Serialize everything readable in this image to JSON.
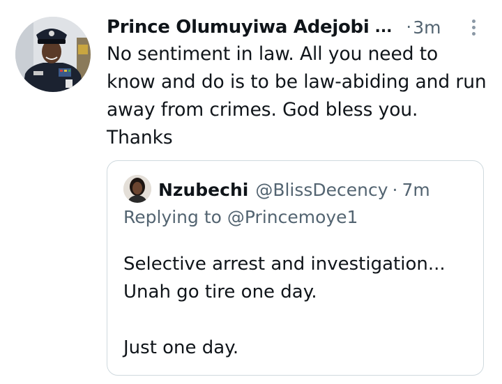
{
  "tweet": {
    "author_name": "Prince Olumuyiwa Adejobi",
    "name_truncation": "...",
    "separator": "·",
    "time": "3m",
    "more_icon": "more-vertical-icon",
    "text": "No sentiment in law. All you need to know and do is to be law-abiding and run away from crimes. God bless you. Thanks"
  },
  "quoted": {
    "author_name": "Nzubechi",
    "handle": "@BlissDecency",
    "separator": "·",
    "time": "7m",
    "reply_prefix": "Replying to",
    "reply_handle": "@Princemoye1",
    "lines": [
      "Selective arrest and investigation...",
      "Unah go tire one day.",
      "",
      "Just one day."
    ]
  },
  "colors": {
    "text_primary": "#0f1419",
    "text_secondary": "#536471",
    "border": "#cfd9de",
    "background": "#ffffff"
  }
}
